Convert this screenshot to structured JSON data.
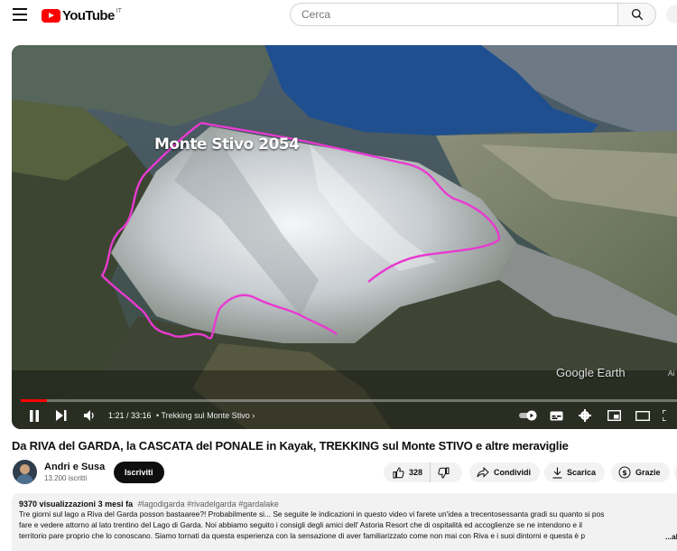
{
  "topbar": {
    "menu_icon": "hamburger-menu-icon",
    "logo_text": "YouTube",
    "logo_country": "IT",
    "search_placeholder": "Cerca",
    "search_icon": "search-icon"
  },
  "player": {
    "overlay_title": "Monte Stivo 2054",
    "watermark": "Google Earth",
    "watermark_extra": "Ai",
    "current_time": "1:21",
    "duration": "33:16",
    "time_display": "1:21 / 33:16",
    "chapter": "• Trekking sul Monte Stivo",
    "chapter_arrow": "›",
    "progress": 0.04,
    "controls": [
      "play-pause-icon",
      "next-icon",
      "volume-icon",
      "autoplay-toggle",
      "subtitles-icon",
      "settings-icon",
      "miniplayer-icon",
      "theater-icon",
      "fullscreen-icon"
    ],
    "colors": {
      "progress": "#ff0000",
      "route": "#e83ad0",
      "lake": "#1f4f8f"
    }
  },
  "video": {
    "title": "Da RIVA del GARDA, la CASCATA del PONALE in Kayak, TREKKING sul Monte STIVO e altre meraviglie"
  },
  "channel": {
    "name": "Andri e Susa",
    "subscribers": "13.200 iscritti",
    "subscribe_label": "Iscriviti"
  },
  "actions": {
    "likes": "328",
    "share_label": "Condividi",
    "download_label": "Scarica",
    "thanks_label": "Grazie"
  },
  "description": {
    "views": "9370 visualizzazioni",
    "age": "3 mesi fa",
    "hashtags": "#lagodigarda #rivadelgarda #gardalake",
    "line1": "Tre giorni sul lago a Riva del Garda posson bastaaree?! Probabilmente si... Se seguite le indicazioni in questo video vi farete un'idea a trecentosessanta gradi su quanto si pos",
    "line2": "fare e vedere attorno al lato trentino del Lago di Garda. Noi abbiamo seguito i consigli degli amici dell' Astoria Resort che di ospitalità ed accoglienze se ne intendono e il",
    "line3": "territorio pare proprio che lo conoscano. Siamo tornati da questa esperienza con la sensazione di aver familiarizzato come non mai con Riva e i suoi dintorni e questa è p",
    "more_label": "...al"
  }
}
